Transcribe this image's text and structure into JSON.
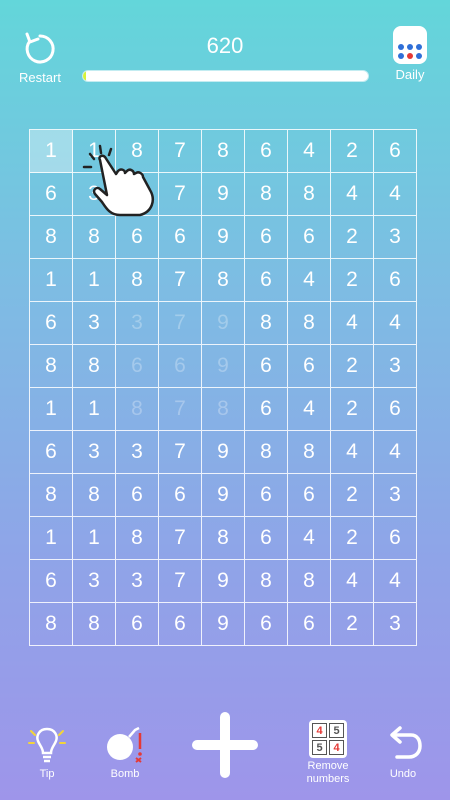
{
  "header": {
    "restart_label": "Restart",
    "score": "620",
    "daily_label": "Daily",
    "progress": 0.012
  },
  "board": {
    "rows": [
      [
        "1",
        "1",
        "8",
        "7",
        "8",
        "6",
        "4",
        "2",
        "6"
      ],
      [
        "6",
        "3",
        "3",
        "7",
        "9",
        "8",
        "8",
        "4",
        "4"
      ],
      [
        "8",
        "8",
        "6",
        "6",
        "9",
        "6",
        "6",
        "2",
        "3"
      ],
      [
        "1",
        "1",
        "8",
        "7",
        "8",
        "6",
        "4",
        "2",
        "6"
      ],
      [
        "6",
        "3",
        "3",
        "7",
        "9",
        "8",
        "8",
        "4",
        "4"
      ],
      [
        "8",
        "8",
        "6",
        "6",
        "9",
        "6",
        "6",
        "2",
        "3"
      ],
      [
        "1",
        "1",
        "8",
        "7",
        "8",
        "6",
        "4",
        "2",
        "6"
      ],
      [
        "6",
        "3",
        "3",
        "7",
        "9",
        "8",
        "8",
        "4",
        "4"
      ],
      [
        "8",
        "8",
        "6",
        "6",
        "9",
        "6",
        "6",
        "2",
        "3"
      ],
      [
        "1",
        "1",
        "8",
        "7",
        "8",
        "6",
        "4",
        "2",
        "6"
      ],
      [
        "6",
        "3",
        "3",
        "7",
        "9",
        "8",
        "8",
        "4",
        "4"
      ],
      [
        "8",
        "8",
        "6",
        "6",
        "9",
        "6",
        "6",
        "2",
        "3"
      ]
    ],
    "faded_cells": [
      [
        4,
        2
      ],
      [
        4,
        3
      ],
      [
        4,
        4
      ],
      [
        5,
        2
      ],
      [
        5,
        3
      ],
      [
        5,
        4
      ],
      [
        6,
        2
      ],
      [
        6,
        3
      ],
      [
        6,
        4
      ]
    ],
    "selected_cell": [
      0,
      0
    ]
  },
  "toolbar": {
    "tip_label": "Tip",
    "bomb_label": "Bomb",
    "remove_label_1": "Remove",
    "remove_label_2": "numbers",
    "undo_label": "Undo",
    "remove_icon_digits": [
      "4",
      "5",
      "5",
      "4"
    ]
  },
  "colors": {
    "progress_fill": "#d7f23a",
    "accent_red": "#e53935",
    "calendar_blue": "#2f6fd8"
  }
}
